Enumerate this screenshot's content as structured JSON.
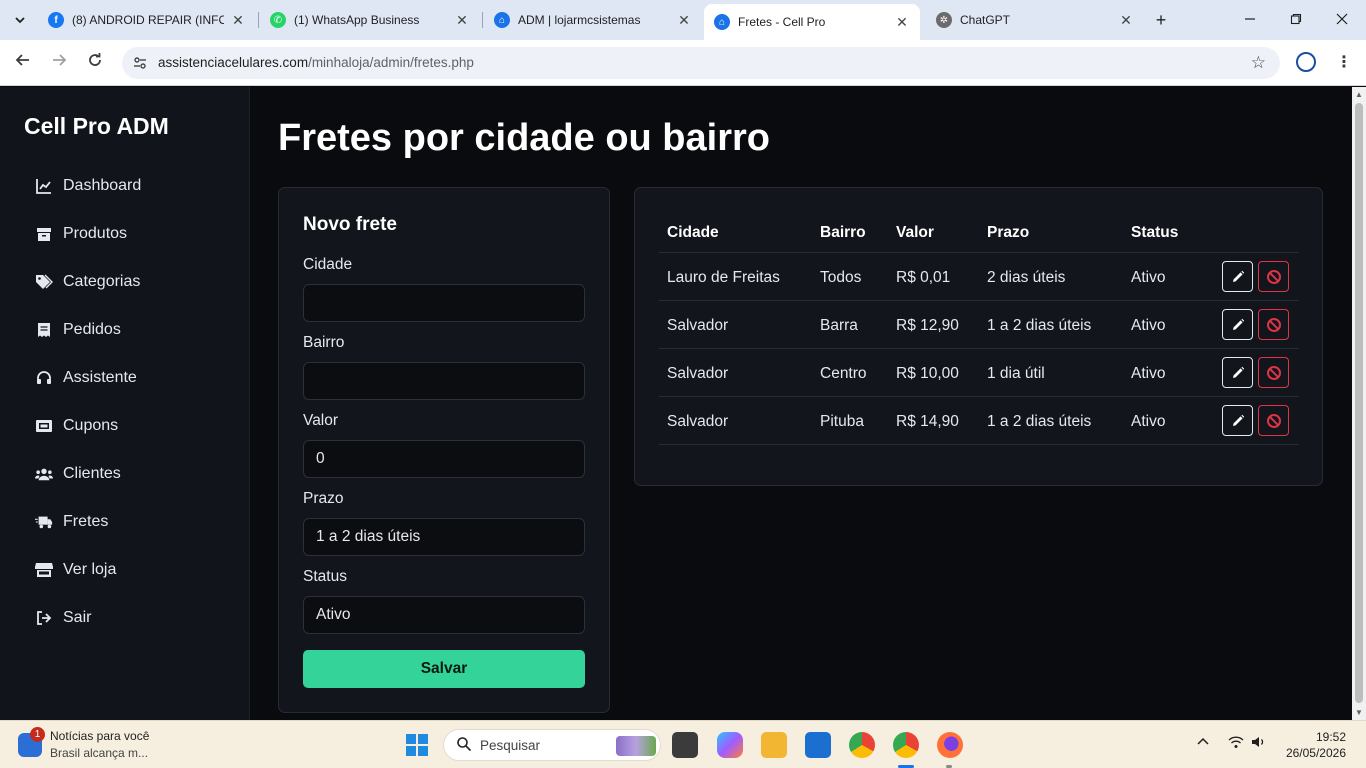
{
  "browser": {
    "tabs": [
      {
        "title": "(8) ANDROID REPAIR (INFO",
        "favicon": "facebook-icon"
      },
      {
        "title": "(1) WhatsApp Business",
        "favicon": "whatsapp-icon"
      },
      {
        "title": "ADM | lojarmcsistemas",
        "favicon": "home-icon"
      },
      {
        "title": "Fretes - Cell Pro",
        "favicon": "home-icon",
        "active": true
      },
      {
        "title": "ChatGPT",
        "favicon": "chatgpt-icon"
      }
    ],
    "url_host": "assistenciacelulares.com",
    "url_path": "/minhaloja/admin/fretes.php"
  },
  "sidebar": {
    "brand": "Cell Pro ADM",
    "items": [
      {
        "label": "Dashboard",
        "icon": "chart-line-icon"
      },
      {
        "label": "Produtos",
        "icon": "box-icon"
      },
      {
        "label": "Categorias",
        "icon": "tags-icon"
      },
      {
        "label": "Pedidos",
        "icon": "receipt-icon"
      },
      {
        "label": "Assistente",
        "icon": "headset-icon"
      },
      {
        "label": "Cupons",
        "icon": "ticket-icon"
      },
      {
        "label": "Clientes",
        "icon": "users-icon"
      },
      {
        "label": "Fretes",
        "icon": "truck-icon"
      },
      {
        "label": "Ver loja",
        "icon": "store-icon"
      },
      {
        "label": "Sair",
        "icon": "sign-out-icon"
      }
    ]
  },
  "main": {
    "title": "Fretes por cidade ou bairro"
  },
  "form": {
    "title": "Novo frete",
    "cidade_label": "Cidade",
    "cidade_value": "",
    "bairro_label": "Bairro",
    "bairro_value": "",
    "valor_label": "Valor",
    "valor_value": "0",
    "prazo_label": "Prazo",
    "prazo_value": "1 a 2 dias úteis",
    "status_label": "Status",
    "status_value": "Ativo",
    "save_label": "Salvar"
  },
  "table": {
    "headers": {
      "cidade": "Cidade",
      "bairro": "Bairro",
      "valor": "Valor",
      "prazo": "Prazo",
      "status": "Status"
    },
    "rows": [
      {
        "cidade": "Lauro de Freitas",
        "bairro": "Todos",
        "valor": "R$ 0,01",
        "prazo": "2 dias úteis",
        "status": "Ativo"
      },
      {
        "cidade": "Salvador",
        "bairro": "Barra",
        "valor": "R$ 12,90",
        "prazo": "1 a 2 dias úteis",
        "status": "Ativo"
      },
      {
        "cidade": "Salvador",
        "bairro": "Centro",
        "valor": "R$ 10,00",
        "prazo": "1 dia útil",
        "status": "Ativo"
      },
      {
        "cidade": "Salvador",
        "bairro": "Pituba",
        "valor": "R$ 14,90",
        "prazo": "1 a 2 dias úteis",
        "status": "Ativo"
      }
    ]
  },
  "taskbar": {
    "news_title": "Notícias para você",
    "news_sub": "Brasil alcança m...",
    "news_badge": "1",
    "search_placeholder": "Pesquisar",
    "time": "19:52",
    "date": "26/05/2026"
  },
  "colors": {
    "accent": "#34d399",
    "danger": "#dc3545",
    "page_bg": "#0a0b0e",
    "card_bg": "#12151c"
  }
}
